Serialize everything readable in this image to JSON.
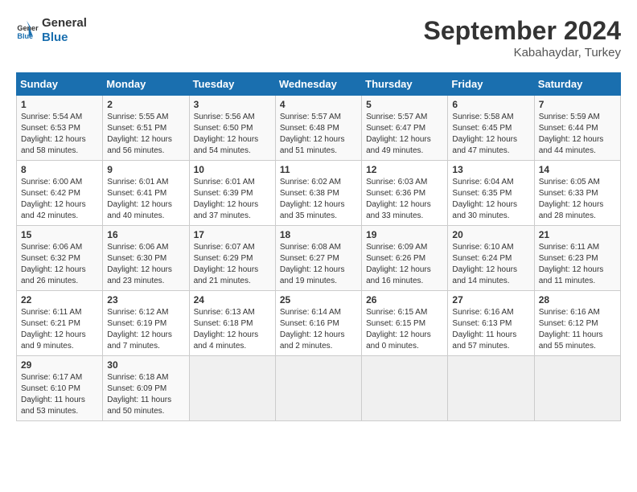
{
  "header": {
    "logo_line1": "General",
    "logo_line2": "Blue",
    "month_title": "September 2024",
    "location": "Kabahaydar, Turkey"
  },
  "weekdays": [
    "Sunday",
    "Monday",
    "Tuesday",
    "Wednesday",
    "Thursday",
    "Friday",
    "Saturday"
  ],
  "weeks": [
    [
      {
        "day": "1",
        "info": "Sunrise: 5:54 AM\nSunset: 6:53 PM\nDaylight: 12 hours\nand 58 minutes."
      },
      {
        "day": "2",
        "info": "Sunrise: 5:55 AM\nSunset: 6:51 PM\nDaylight: 12 hours\nand 56 minutes."
      },
      {
        "day": "3",
        "info": "Sunrise: 5:56 AM\nSunset: 6:50 PM\nDaylight: 12 hours\nand 54 minutes."
      },
      {
        "day": "4",
        "info": "Sunrise: 5:57 AM\nSunset: 6:48 PM\nDaylight: 12 hours\nand 51 minutes."
      },
      {
        "day": "5",
        "info": "Sunrise: 5:57 AM\nSunset: 6:47 PM\nDaylight: 12 hours\nand 49 minutes."
      },
      {
        "day": "6",
        "info": "Sunrise: 5:58 AM\nSunset: 6:45 PM\nDaylight: 12 hours\nand 47 minutes."
      },
      {
        "day": "7",
        "info": "Sunrise: 5:59 AM\nSunset: 6:44 PM\nDaylight: 12 hours\nand 44 minutes."
      }
    ],
    [
      {
        "day": "8",
        "info": "Sunrise: 6:00 AM\nSunset: 6:42 PM\nDaylight: 12 hours\nand 42 minutes."
      },
      {
        "day": "9",
        "info": "Sunrise: 6:01 AM\nSunset: 6:41 PM\nDaylight: 12 hours\nand 40 minutes."
      },
      {
        "day": "10",
        "info": "Sunrise: 6:01 AM\nSunset: 6:39 PM\nDaylight: 12 hours\nand 37 minutes."
      },
      {
        "day": "11",
        "info": "Sunrise: 6:02 AM\nSunset: 6:38 PM\nDaylight: 12 hours\nand 35 minutes."
      },
      {
        "day": "12",
        "info": "Sunrise: 6:03 AM\nSunset: 6:36 PM\nDaylight: 12 hours\nand 33 minutes."
      },
      {
        "day": "13",
        "info": "Sunrise: 6:04 AM\nSunset: 6:35 PM\nDaylight: 12 hours\nand 30 minutes."
      },
      {
        "day": "14",
        "info": "Sunrise: 6:05 AM\nSunset: 6:33 PM\nDaylight: 12 hours\nand 28 minutes."
      }
    ],
    [
      {
        "day": "15",
        "info": "Sunrise: 6:06 AM\nSunset: 6:32 PM\nDaylight: 12 hours\nand 26 minutes."
      },
      {
        "day": "16",
        "info": "Sunrise: 6:06 AM\nSunset: 6:30 PM\nDaylight: 12 hours\nand 23 minutes."
      },
      {
        "day": "17",
        "info": "Sunrise: 6:07 AM\nSunset: 6:29 PM\nDaylight: 12 hours\nand 21 minutes."
      },
      {
        "day": "18",
        "info": "Sunrise: 6:08 AM\nSunset: 6:27 PM\nDaylight: 12 hours\nand 19 minutes."
      },
      {
        "day": "19",
        "info": "Sunrise: 6:09 AM\nSunset: 6:26 PM\nDaylight: 12 hours\nand 16 minutes."
      },
      {
        "day": "20",
        "info": "Sunrise: 6:10 AM\nSunset: 6:24 PM\nDaylight: 12 hours\nand 14 minutes."
      },
      {
        "day": "21",
        "info": "Sunrise: 6:11 AM\nSunset: 6:23 PM\nDaylight: 12 hours\nand 11 minutes."
      }
    ],
    [
      {
        "day": "22",
        "info": "Sunrise: 6:11 AM\nSunset: 6:21 PM\nDaylight: 12 hours\nand 9 minutes."
      },
      {
        "day": "23",
        "info": "Sunrise: 6:12 AM\nSunset: 6:19 PM\nDaylight: 12 hours\nand 7 minutes."
      },
      {
        "day": "24",
        "info": "Sunrise: 6:13 AM\nSunset: 6:18 PM\nDaylight: 12 hours\nand 4 minutes."
      },
      {
        "day": "25",
        "info": "Sunrise: 6:14 AM\nSunset: 6:16 PM\nDaylight: 12 hours\nand 2 minutes."
      },
      {
        "day": "26",
        "info": "Sunrise: 6:15 AM\nSunset: 6:15 PM\nDaylight: 12 hours\nand 0 minutes."
      },
      {
        "day": "27",
        "info": "Sunrise: 6:16 AM\nSunset: 6:13 PM\nDaylight: 11 hours\nand 57 minutes."
      },
      {
        "day": "28",
        "info": "Sunrise: 6:16 AM\nSunset: 6:12 PM\nDaylight: 11 hours\nand 55 minutes."
      }
    ],
    [
      {
        "day": "29",
        "info": "Sunrise: 6:17 AM\nSunset: 6:10 PM\nDaylight: 11 hours\nand 53 minutes."
      },
      {
        "day": "30",
        "info": "Sunrise: 6:18 AM\nSunset: 6:09 PM\nDaylight: 11 hours\nand 50 minutes."
      },
      {
        "day": "",
        "info": ""
      },
      {
        "day": "",
        "info": ""
      },
      {
        "day": "",
        "info": ""
      },
      {
        "day": "",
        "info": ""
      },
      {
        "day": "",
        "info": ""
      }
    ]
  ]
}
